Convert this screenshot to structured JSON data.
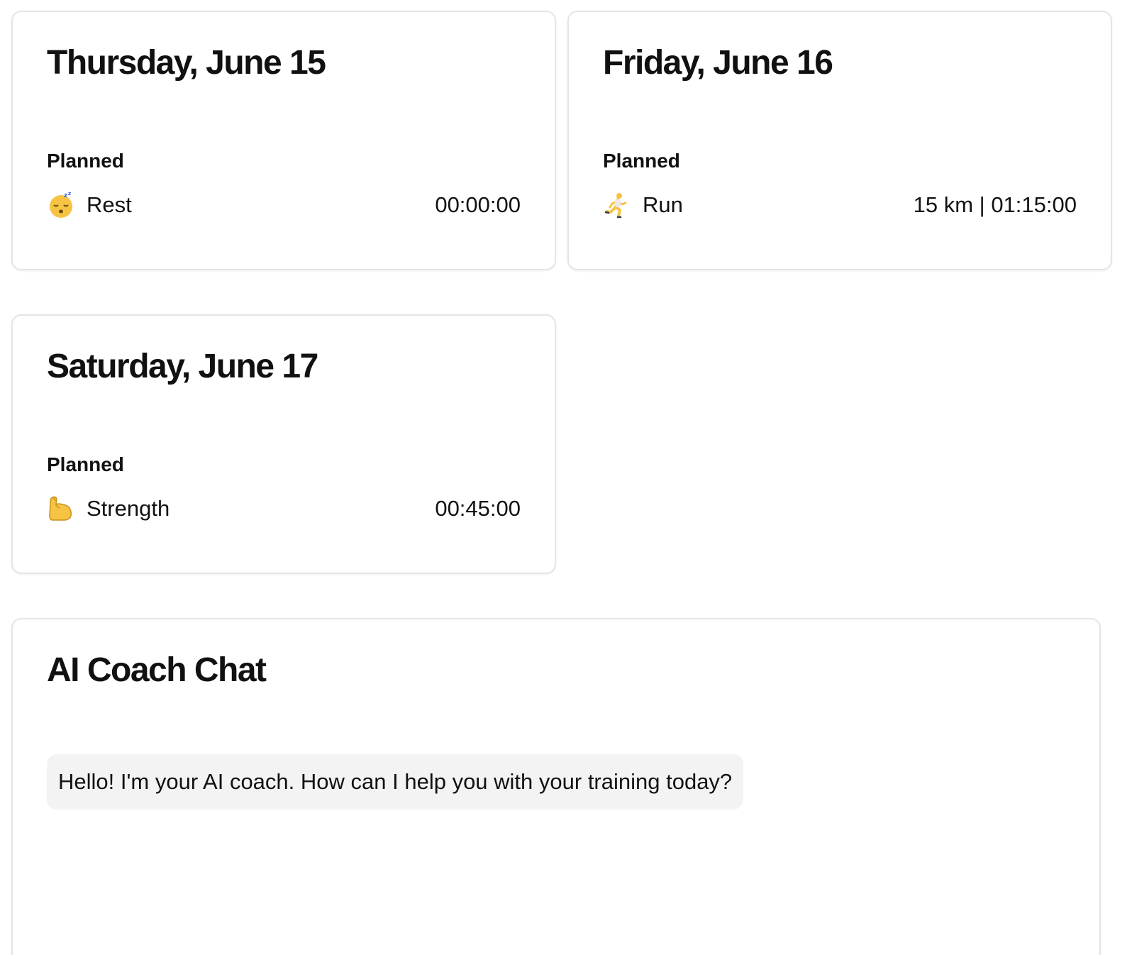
{
  "days": [
    {
      "title": "Thursday, June 15",
      "planned_label": "Planned",
      "activity": {
        "icon": "sleeping-face-icon",
        "icon_glyph": "😴",
        "name": "Rest",
        "value": "00:00:00"
      }
    },
    {
      "title": "Friday, June 16",
      "planned_label": "Planned",
      "activity": {
        "icon": "runner-icon",
        "icon_glyph": "🏃",
        "name": "Run",
        "value": "15 km | 01:15:00"
      }
    },
    {
      "title": "Saturday, June 17",
      "planned_label": "Planned",
      "activity": {
        "icon": "flexed-biceps-icon",
        "icon_glyph": "💪",
        "name": "Strength",
        "value": "00:45:00"
      }
    }
  ],
  "chat": {
    "title": "AI Coach Chat",
    "messages": [
      {
        "sender": "coach",
        "text": "Hello! I'm your AI coach. How can I help you with your training today?"
      }
    ]
  },
  "colors": {
    "card_border": "#e5e5e5",
    "bubble_background": "#f3f3f3",
    "text": "#111111",
    "emoji_yellow": "#f6c343"
  }
}
